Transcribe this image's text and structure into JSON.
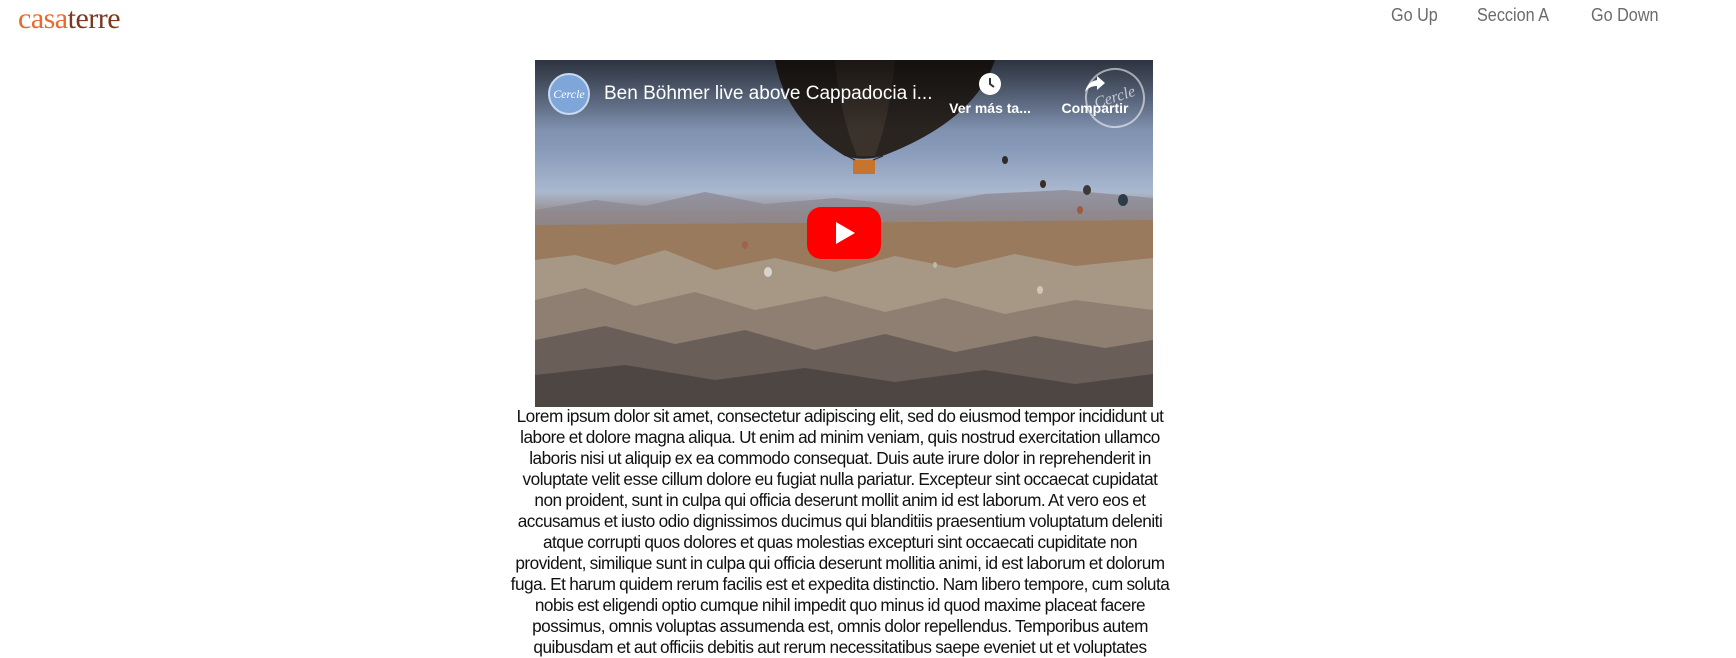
{
  "header": {
    "logo_part1": "casa",
    "logo_part2": "terre",
    "nav": [
      "Go Up",
      "Seccion A",
      "Go Down"
    ]
  },
  "video": {
    "title": "Ben Böhmer live above Cappadocia i...",
    "channel_avatar_text": "Cercle",
    "watch_later_label": "Ver más ta...",
    "share_label": "Compartir",
    "watermark_text": "Cercle",
    "play_icon": "youtube-play-icon"
  },
  "content": {
    "paragraph": "Lorem ipsum dolor sit amet, consectetur adipiscing elit, sed do eiusmod tempor incididunt ut labore et dolore magna aliqua. Ut enim ad minim veniam, quis nostrud exercitation ullamco laboris nisi ut aliquip ex ea commodo consequat. Duis aute irure dolor in reprehenderit in voluptate velit esse cillum dolore eu fugiat nulla pariatur. Excepteur sint occaecat cupidatat non proident, sunt in culpa qui officia deserunt mollit anim id est laborum. At vero eos et accusamus et iusto odio dignissimos ducimus qui blanditiis praesentium voluptatum deleniti atque corrupti quos dolores et quas molestias excepturi sint occaecati cupiditate non provident, similique sunt in culpa qui officia deserunt mollitia animi, id est laborum et dolorum fuga. Et harum quidem rerum facilis est et expedita distinctio. Nam libero tempore, cum soluta nobis est eligendi optio cumque nihil impedit quo minus id quod maxime placeat facere possimus, omnis voluptas assumenda est, omnis dolor repellendus. Temporibus autem quibusdam et aut officiis debitis aut rerum necessitatibus saepe eveniet ut et voluptates"
  },
  "colors": {
    "logo_orange": "#e86a2e",
    "logo_brown": "#7a3a1e",
    "nav_gray": "#6b6b6b",
    "play_red": "#ff0000"
  }
}
